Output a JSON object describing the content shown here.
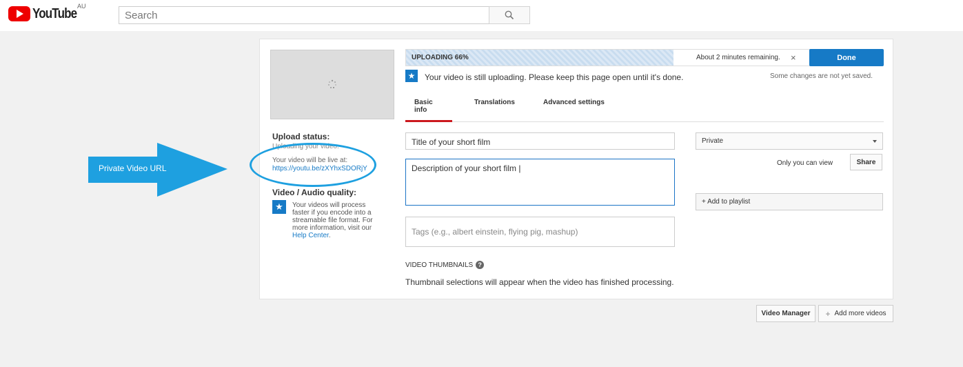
{
  "header": {
    "logo_text": "YouTube",
    "region": "AU",
    "search_placeholder": "Search"
  },
  "upload": {
    "progress_label": "UPLOADING 66%",
    "progress_percent": 66,
    "remaining": "About 2 minutes remaining.",
    "cancel": "×",
    "done_label": "Done",
    "notice": "Your video is still uploading. Please keep this page open until it's done.",
    "unsaved": "Some changes are not yet saved."
  },
  "tabs": [
    {
      "label": "Basic info",
      "active": true
    },
    {
      "label": "Translations",
      "active": false
    },
    {
      "label": "Advanced settings",
      "active": false
    }
  ],
  "sidebar": {
    "status_heading": "Upload status:",
    "status_line": "Uploading your video.",
    "live_label": "Your video will be live at:",
    "live_url": "https://youtu.be/zXYhxSDORjY",
    "quality_heading": "Video / Audio quality:",
    "quality_text": "Your videos will process faster if you encode into a streamable file format. For more information, visit our",
    "help_link": "Help Center",
    "help_suffix": "."
  },
  "form": {
    "title_value": "Title of your short film",
    "description_value": "Description of your short film |",
    "tags_placeholder": "Tags (e.g., albert einstein, flying pig, mashup)",
    "privacy_value": "Private",
    "only_you": "Only you can view",
    "share_label": "Share",
    "playlist_label": "+ Add to playlist",
    "thumbnails_heading": "VIDEO THUMBNAILS",
    "thumbnails_note": "Thumbnail selections will appear when the video has finished processing."
  },
  "footer": {
    "video_manager": "Video Manager",
    "add_more": "Add more videos"
  },
  "annotation": {
    "label": "Private Video URL",
    "color": "#1ea0e0"
  }
}
